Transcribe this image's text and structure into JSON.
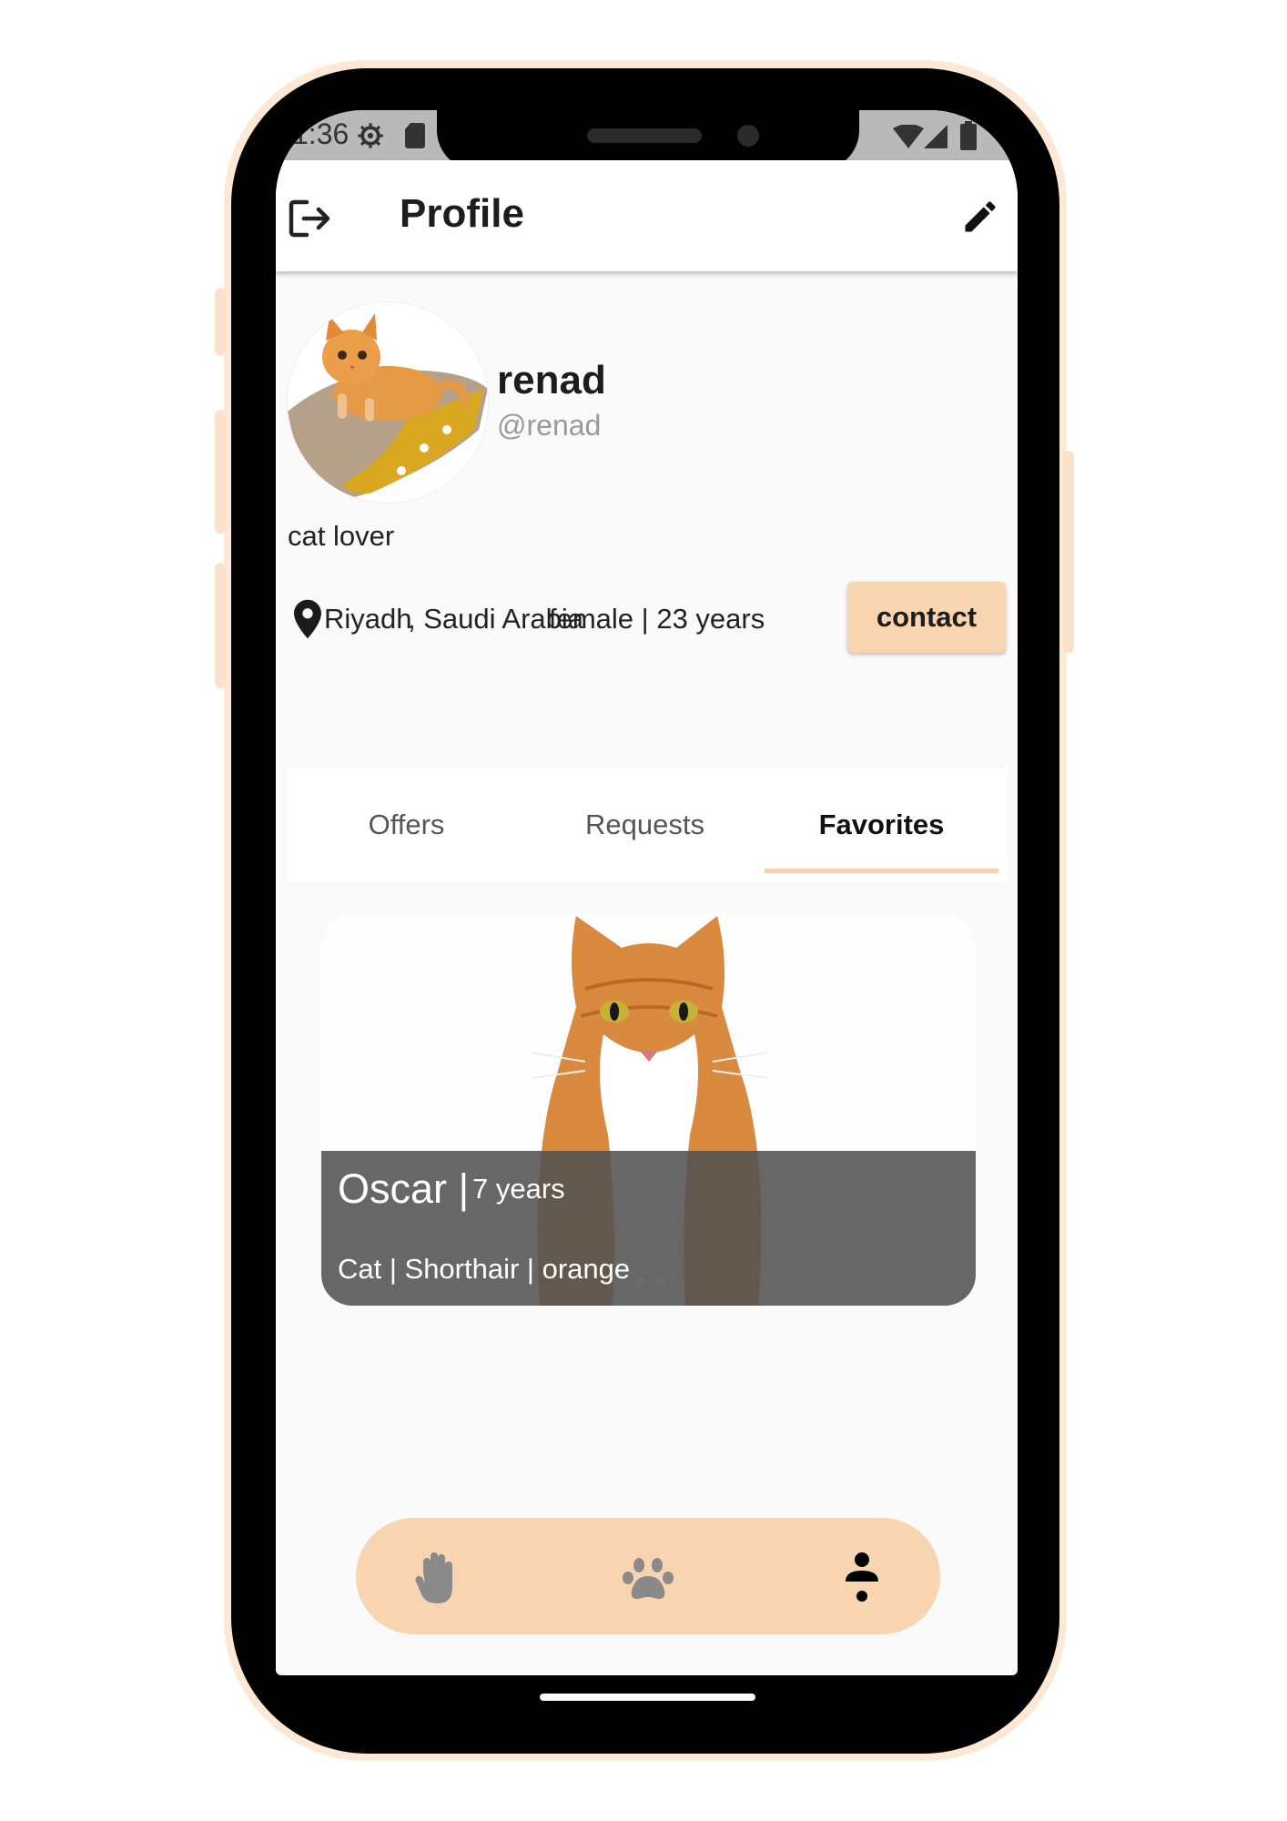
{
  "status_bar": {
    "time": "1:36"
  },
  "app_bar": {
    "title": "Profile"
  },
  "profile": {
    "name": "renad",
    "username": "@renad",
    "bio": "cat lover",
    "city": "Riyadh",
    "country": ", Saudi Arabia",
    "gender_age": "female | 23 years",
    "contact_label": "contact"
  },
  "tabs": [
    {
      "label": "Offers",
      "selected": false
    },
    {
      "label": "Requests",
      "selected": false
    },
    {
      "label": "Favorites",
      "selected": true
    }
  ],
  "favorite_card": {
    "name": "Oscar |",
    "age": "7 years",
    "details": "Cat | Shorthair | orange"
  },
  "bottom_nav": {
    "items": [
      "hand-icon",
      "paw-icon",
      "person-icon"
    ],
    "selected": "person-icon"
  },
  "colors": {
    "accent": "#f8d4b0",
    "frame": "#fde8d6",
    "overlay": "#505050"
  }
}
